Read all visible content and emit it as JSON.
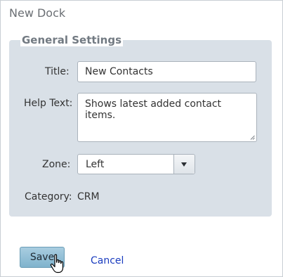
{
  "dialog": {
    "title": "New Dock"
  },
  "general_settings": {
    "legend": "General Settings",
    "title_label": "Title:",
    "title_value": "New Contacts",
    "help_text_label": "Help Text:",
    "help_text_value": "Shows latest added contact items.",
    "zone_label": "Zone:",
    "zone_value": "Left",
    "category_label": "Category:",
    "category_value": "CRM"
  },
  "actions": {
    "save_label": "Save",
    "cancel_label": "Cancel"
  },
  "colors": {
    "fieldset_bg": "#d9e0e7",
    "save_button_bg": "#8fbdd5",
    "link": "#1a3cbf"
  },
  "icons": {
    "dropdown": "chevron-down-icon",
    "cursor": "hand-pointer-icon",
    "resize": "resize-grip-icon"
  }
}
